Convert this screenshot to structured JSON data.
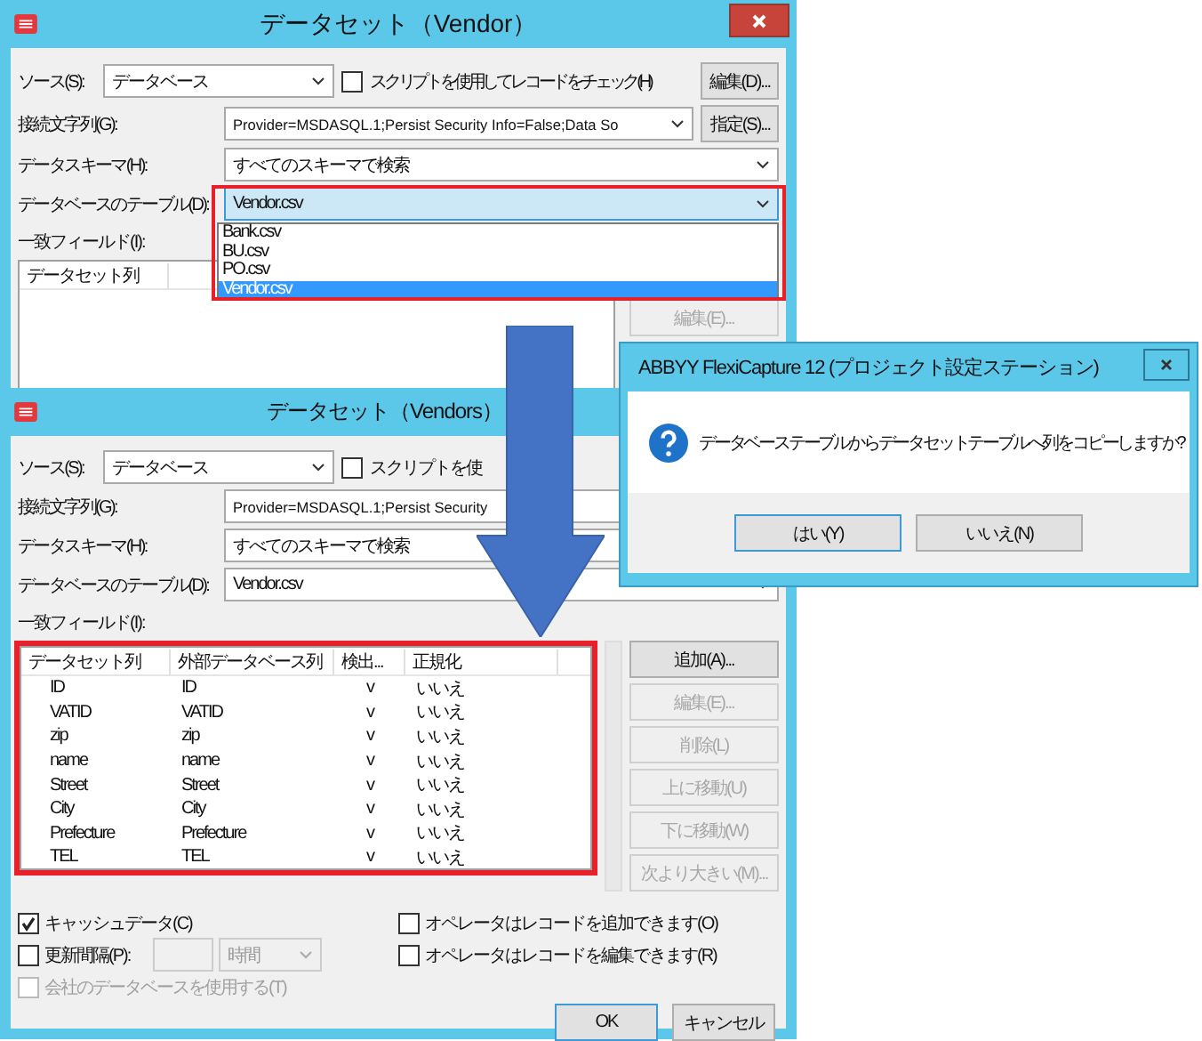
{
  "back_window": {
    "title": "データセット（Vendor）",
    "source": {
      "label": "ソース(S):",
      "value": "データベース"
    },
    "script_check": {
      "label": "スクリプトを使用してレコードをチェック(H)",
      "checked": false
    },
    "edit_button": "編集(D)...",
    "connection": {
      "label": "接続文字列(G):",
      "value": "Provider=MSDASQL.1;Persist Security Info=False;Data So"
    },
    "specify_button": "指定(S)...",
    "schema": {
      "label": "データスキーマ(H):",
      "value": "すべてのスキーマで検索"
    },
    "table": {
      "label": "データベースのテーブル(D):",
      "value": "Vendor.csv",
      "options": [
        {
          "label": "Bank.csv",
          "selected": false
        },
        {
          "label": "BU.csv",
          "selected": false
        },
        {
          "label": "PO.csv",
          "selected": false
        },
        {
          "label": "Vendor.csv",
          "selected": true
        }
      ]
    },
    "match_label": "一致フィールド(I):",
    "columns": [
      "データセット列"
    ],
    "side_buttons": [
      {
        "label": "編集(E)...",
        "disabled": true
      }
    ]
  },
  "front_window": {
    "title": "データセット（Vendors）",
    "source": {
      "label": "ソース(S):",
      "value": "データベース"
    },
    "script_check": {
      "label": "スクリプトを使",
      "checked": false
    },
    "connection": {
      "label": "接続文字列(G):",
      "value": "Provider=MSDASQL.1;Persist Security"
    },
    "schema": {
      "label": "データスキーマ(H):",
      "value": "すべてのスキーマで検索"
    },
    "table": {
      "label": "データベースのテーブル(D):",
      "value": "Vendor.csv"
    },
    "match_label": "一致フィールド(I):",
    "columns": [
      "データセット列",
      "外部データベース列",
      "検出...",
      "正規化"
    ],
    "rows": [
      {
        "cells": [
          "ID",
          "ID",
          "v",
          "いいえ"
        ]
      },
      {
        "cells": [
          "VATID",
          "VATID",
          "v",
          "いいえ"
        ]
      },
      {
        "cells": [
          "zip",
          "zip",
          "v",
          "いいえ"
        ]
      },
      {
        "cells": [
          "name",
          "name",
          "v",
          "いいえ"
        ]
      },
      {
        "cells": [
          "Street",
          "Street",
          "v",
          "いいえ"
        ]
      },
      {
        "cells": [
          "City",
          "City",
          "v",
          "いいえ"
        ]
      },
      {
        "cells": [
          "Prefecture",
          "Prefecture",
          "v",
          "いいえ"
        ]
      },
      {
        "cells": [
          "TEL",
          "TEL",
          "v",
          "いいえ"
        ]
      }
    ],
    "side_buttons": [
      {
        "label": "追加(A)...",
        "disabled": false
      },
      {
        "label": "編集(E)...",
        "disabled": true
      },
      {
        "label": "削除(L)",
        "disabled": true
      },
      {
        "label": "上に移動(U)",
        "disabled": true
      },
      {
        "label": "下に移動(W)",
        "disabled": true
      },
      {
        "label": "次より大きい(M)...",
        "disabled": true
      }
    ],
    "left_options": [
      {
        "kind": "checkbox",
        "label": "キャッシュデータ(C)",
        "checked": true,
        "disabled": false
      },
      {
        "kind": "interval",
        "label": "更新間隔(P):",
        "checked": false,
        "disabled": false,
        "unit": "時間"
      },
      {
        "kind": "checkbox",
        "label": "会社のデータベースを使用する(T)",
        "checked": false,
        "disabled": true
      }
    ],
    "right_options": [
      {
        "label": "オペレータはレコードを追加できます(O)",
        "checked": false
      },
      {
        "label": "オペレータはレコードを編集できます(R)",
        "checked": false
      }
    ],
    "buttons": [
      {
        "label": "OK",
        "default": true
      },
      {
        "label": "キャンセル",
        "default": false
      }
    ]
  },
  "dialog": {
    "title": "ABBYY FlexiCapture 12 (プロジェクト設定ステーション)",
    "message": "データベーステーブルからデータセットテーブルへ列をコピーしますか?",
    "buttons": [
      {
        "label": "はい(Y)",
        "selected": true
      },
      {
        "label": "いいえ(N)",
        "selected": false
      }
    ]
  }
}
